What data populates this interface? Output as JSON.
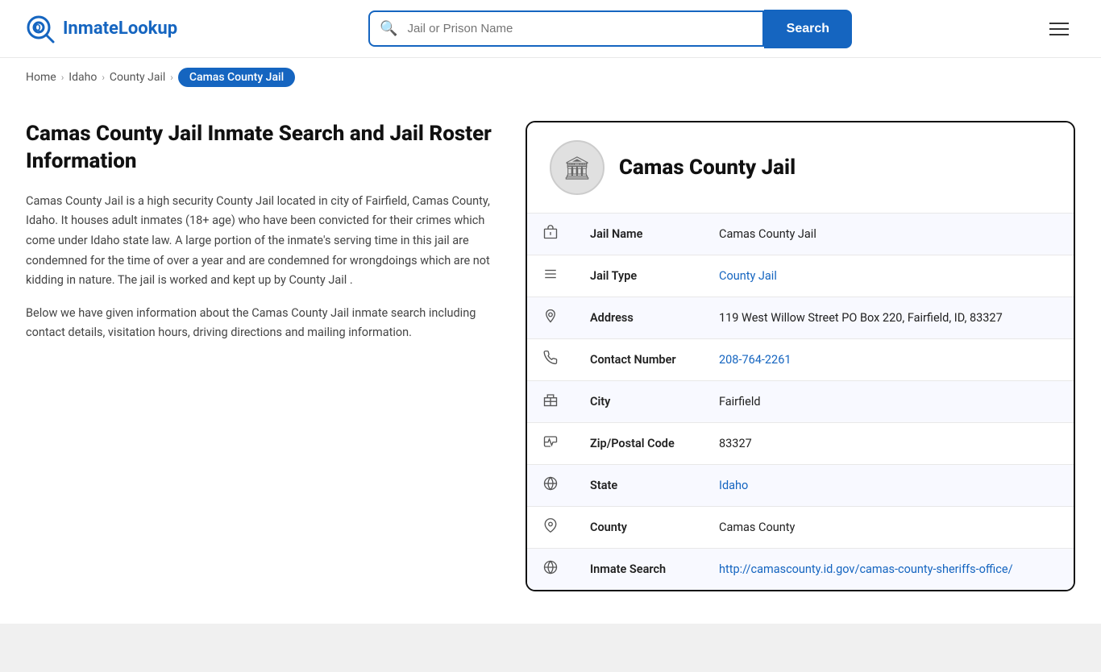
{
  "header": {
    "logo_text_part1": "Inmate",
    "logo_text_part2": "Lookup",
    "search_placeholder": "Jail or Prison Name",
    "search_button_label": "Search"
  },
  "breadcrumb": {
    "home": "Home",
    "state": "Idaho",
    "type": "County Jail",
    "current": "Camas County Jail"
  },
  "left_panel": {
    "heading": "Camas County Jail Inmate Search and Jail Roster Information",
    "para1": "Camas County Jail is a high security County Jail located in city of Fairfield, Camas County, Idaho. It houses adult inmates (18+ age) who have been convicted for their crimes which come under Idaho state law. A large portion of the inmate's serving time in this jail are condemned for the time of over a year and are condemned for wrongdoings which are not kidding in nature. The jail is worked and kept up by County Jail .",
    "para2": "Below we have given information about the Camas County Jail inmate search including contact details, visitation hours, driving directions and mailing information."
  },
  "card": {
    "title": "Camas County Jail",
    "avatar_icon": "🏛",
    "fields": [
      {
        "icon": "🏛",
        "label": "Jail Name",
        "value": "Camas County Jail",
        "link": null
      },
      {
        "icon": "☰",
        "label": "Jail Type",
        "value": "County Jail",
        "link": "#"
      },
      {
        "icon": "📍",
        "label": "Address",
        "value": "119 West Willow Street PO Box 220, Fairfield, ID, 83327",
        "link": null
      },
      {
        "icon": "📞",
        "label": "Contact Number",
        "value": "208-764-2261",
        "link": "tel:208-764-2261"
      },
      {
        "icon": "🏙",
        "label": "City",
        "value": "Fairfield",
        "link": null
      },
      {
        "icon": "✉",
        "label": "Zip/Postal Code",
        "value": "83327",
        "link": null
      },
      {
        "icon": "🌐",
        "label": "State",
        "value": "Idaho",
        "link": "#"
      },
      {
        "icon": "🗂",
        "label": "County",
        "value": "Camas County",
        "link": null
      },
      {
        "icon": "🌐",
        "label": "Inmate Search",
        "value": "http://camascounty.id.gov/camas-county-sheriffs-office/",
        "link": "http://camascounty.id.gov/camas-county-sheriffs-office/"
      }
    ]
  }
}
